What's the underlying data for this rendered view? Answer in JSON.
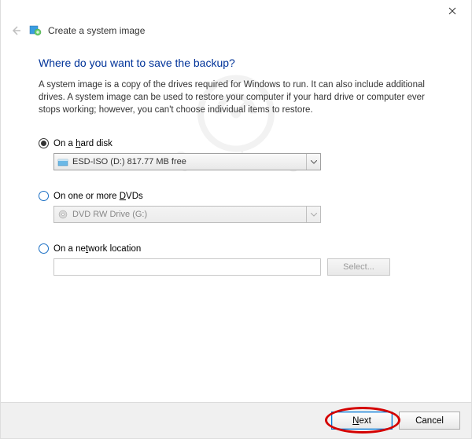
{
  "window": {
    "title": "Create a system image"
  },
  "page": {
    "heading": "Where do you want to save the backup?",
    "description": "A system image is a copy of the drives required for Windows to run. It can also include additional drives. A system image can be used to restore your computer if your hard drive or computer ever stops working; however, you can't choose individual items to restore."
  },
  "options": {
    "hard_disk": {
      "prefix": "On a ",
      "underlined": "h",
      "suffix": "ard disk",
      "select_value": "ESD-ISO (D:)  817.77 MB free",
      "selected": true
    },
    "dvds": {
      "prefix": "On one or more ",
      "underlined": "D",
      "suffix": "VDs",
      "select_value": "DVD RW Drive (G:)",
      "selected": false
    },
    "network": {
      "prefix": "On a ne",
      "underlined": "t",
      "suffix": "work location",
      "select_label": "Select...",
      "value": "",
      "selected": false
    }
  },
  "footer": {
    "next_underlined": "N",
    "next_rest": "ext",
    "cancel": "Cancel"
  }
}
